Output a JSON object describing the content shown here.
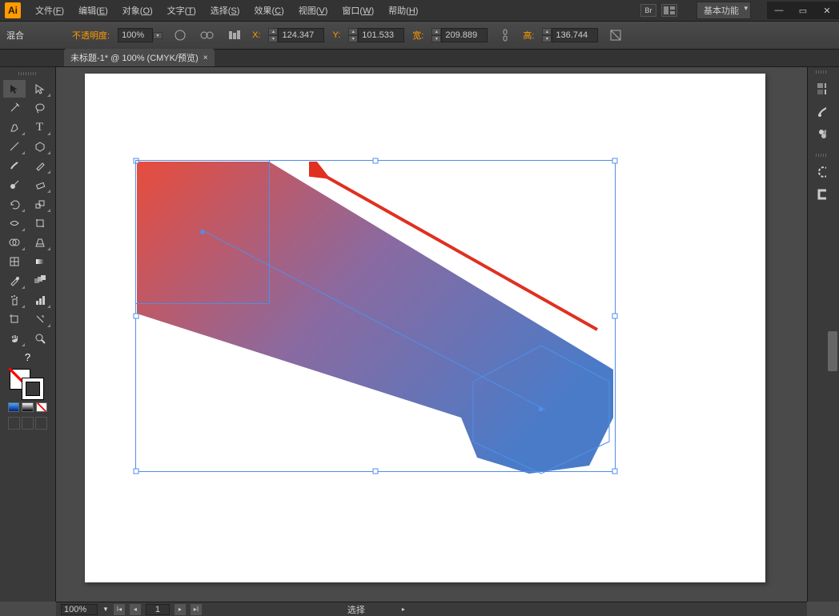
{
  "app": {
    "logo": "Ai"
  },
  "menu": [
    {
      "label": "文件",
      "accel": "F"
    },
    {
      "label": "编辑",
      "accel": "E"
    },
    {
      "label": "对象",
      "accel": "O"
    },
    {
      "label": "文字",
      "accel": "T"
    },
    {
      "label": "选择",
      "accel": "S"
    },
    {
      "label": "效果",
      "accel": "C"
    },
    {
      "label": "视图",
      "accel": "V"
    },
    {
      "label": "窗口",
      "accel": "W"
    },
    {
      "label": "帮助",
      "accel": "H"
    }
  ],
  "workspace": {
    "label": "基本功能"
  },
  "controlbar": {
    "tool_label": "混合",
    "opacity_label": "不透明度:",
    "opacity_value": "100%",
    "x_label": "X:",
    "x_value": "124.347",
    "y_label": "Y:",
    "y_value": "101.533",
    "w_label": "宽:",
    "w_value": "209.889",
    "h_label": "高:",
    "h_value": "136.744"
  },
  "doc_tab": {
    "title": "未标题-1* @ 100% (CMYK/预览)"
  },
  "toolbox": {
    "help": "?"
  },
  "statusbar": {
    "zoom": "100%",
    "page": "1",
    "mode": "选择"
  }
}
